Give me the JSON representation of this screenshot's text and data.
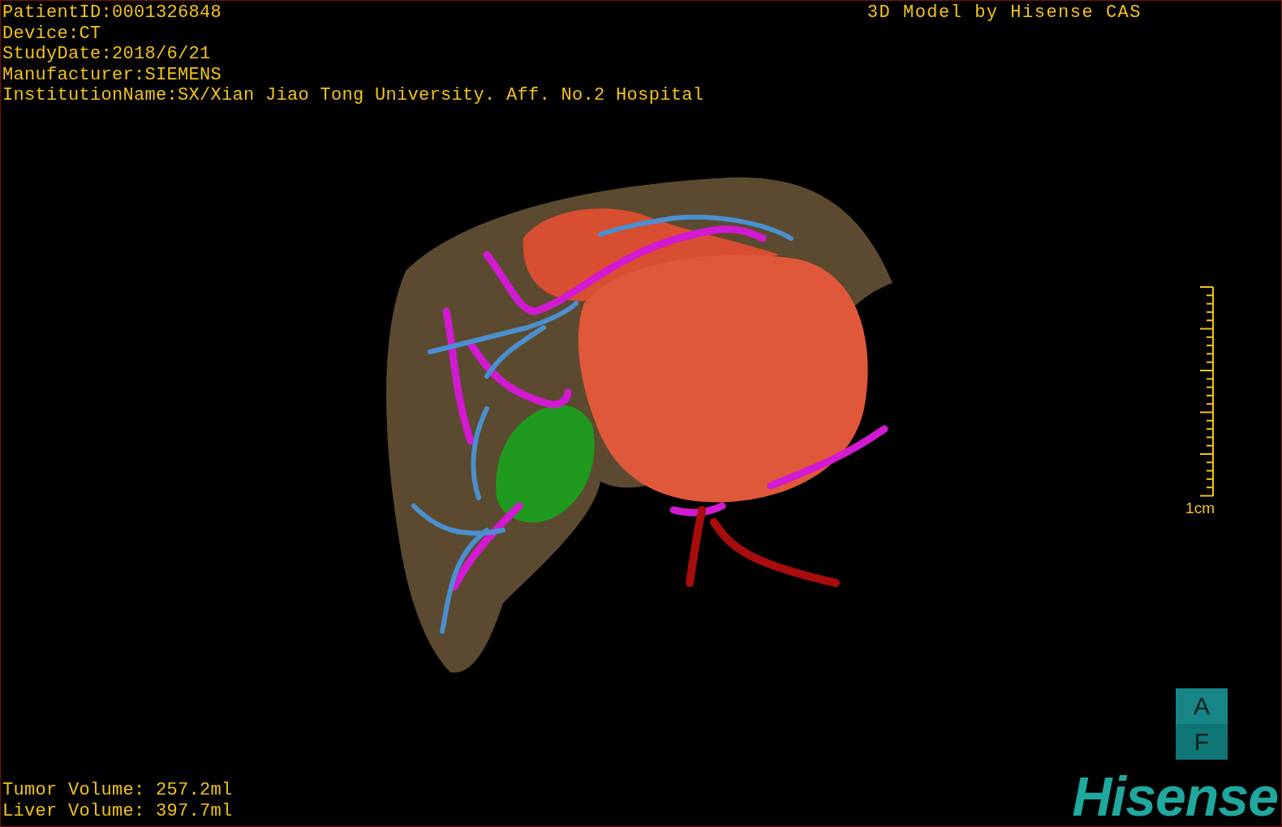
{
  "overlay_info": {
    "patient_lines": [
      "PatientID:0001326848",
      "Device:CT",
      "StudyDate:2018/6/21",
      "Manufacturer:SIEMENS",
      "InstitutionName:SX/Xian Jiao Tong University. Aff. No.2 Hospital"
    ],
    "title": "3D Model by Hisense CAS"
  },
  "scale_bar": {
    "label": "1cm"
  },
  "orientation_cube": {
    "top": "A",
    "bottom": "F"
  },
  "volumes": [
    "Tumor Volume: 257.2ml",
    "Liver Volume: 397.7ml"
  ],
  "logo": "Hisense"
}
